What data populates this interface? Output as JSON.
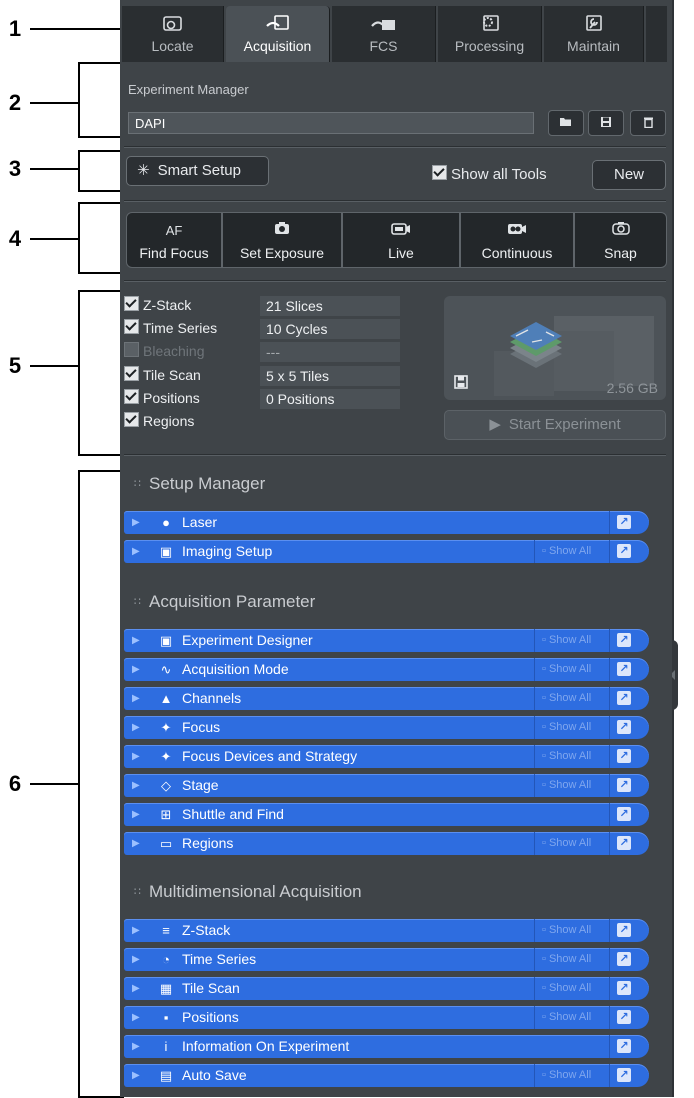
{
  "callouts": [
    "1",
    "2",
    "3",
    "4",
    "5",
    "6"
  ],
  "tabs": [
    {
      "label": "Locate",
      "icon": "locate-icon"
    },
    {
      "label": "Acquisition",
      "icon": "acquisition-icon"
    },
    {
      "label": "FCS",
      "icon": "fcs-icon"
    },
    {
      "label": "Processing",
      "icon": "processing-icon"
    },
    {
      "label": "Maintain",
      "icon": "maintain-icon"
    }
  ],
  "experiment_manager": {
    "label": "Experiment Manager",
    "value": "DAPI",
    "buttons": [
      "open-icon",
      "save-icon",
      "delete-icon"
    ]
  },
  "setup_row": {
    "smart_setup_label": "Smart Setup",
    "show_all_tools_label": "Show all Tools",
    "show_all_tools_checked": true,
    "new_label": "New"
  },
  "acq_buttons": [
    {
      "icon_text": "AF",
      "label": "Find Focus"
    },
    {
      "icon_text": "",
      "label": "Set Exposure"
    },
    {
      "icon_text": "",
      "label": "Live"
    },
    {
      "icon_text": "",
      "label": "Continuous"
    },
    {
      "icon_text": "",
      "label": "Snap"
    }
  ],
  "dimensions": [
    {
      "label": "Z-Stack",
      "value": "21 Slices",
      "checked": true,
      "enabled": true
    },
    {
      "label": "Time Series",
      "value": "10 Cycles",
      "checked": true,
      "enabled": true
    },
    {
      "label": "Bleaching",
      "value": "---",
      "checked": false,
      "enabled": false
    },
    {
      "label": "Tile Scan",
      "value": "5 x 5 Tiles",
      "checked": true,
      "enabled": true
    },
    {
      "label": "Positions",
      "value": "0 Positions",
      "checked": true,
      "enabled": true
    },
    {
      "label": "Regions",
      "value": "",
      "checked": true,
      "enabled": true
    }
  ],
  "preview": {
    "size": "2.56 GB"
  },
  "start_experiment_label": "Start Experiment",
  "show_all_label": "Show All",
  "groups": [
    {
      "title": "Setup Manager",
      "tools": [
        {
          "label": "Laser",
          "icon": "laser-icon",
          "show_all": false
        },
        {
          "label": "Imaging Setup",
          "icon": "imaging-setup-icon",
          "show_all": true
        }
      ]
    },
    {
      "title": "Acquisition Parameter",
      "tools": [
        {
          "label": "Experiment Designer",
          "icon": "experiment-designer-icon",
          "show_all": true
        },
        {
          "label": "Acquisition Mode",
          "icon": "acquisition-mode-icon",
          "show_all": true
        },
        {
          "label": "Channels",
          "icon": "channels-icon",
          "show_all": true
        },
        {
          "label": "Focus",
          "icon": "focus-icon",
          "show_all": true
        },
        {
          "label": "Focus Devices and Strategy",
          "icon": "focus-devices-icon",
          "show_all": true
        },
        {
          "label": "Stage",
          "icon": "stage-icon",
          "show_all": true
        },
        {
          "label": "Shuttle and Find",
          "icon": "shuttle-find-icon",
          "show_all": false
        },
        {
          "label": "Regions",
          "icon": "regions-icon",
          "show_all": true
        }
      ]
    },
    {
      "title": "Multidimensional Acquisition",
      "tools": [
        {
          "label": "Z-Stack",
          "icon": "z-stack-icon",
          "show_all": true
        },
        {
          "label": "Time Series",
          "icon": "time-series-icon",
          "show_all": true
        },
        {
          "label": "Tile Scan",
          "icon": "tile-scan-icon",
          "show_all": true
        },
        {
          "label": "Positions",
          "icon": "positions-icon",
          "show_all": true
        },
        {
          "label": "Information On Experiment",
          "icon": "information-icon",
          "show_all": false
        },
        {
          "label": "Auto Save",
          "icon": "auto-save-icon",
          "show_all": true
        }
      ]
    }
  ],
  "colors": {
    "tool_bar": "#2e6de0",
    "panel_bg": "#3f4448"
  }
}
